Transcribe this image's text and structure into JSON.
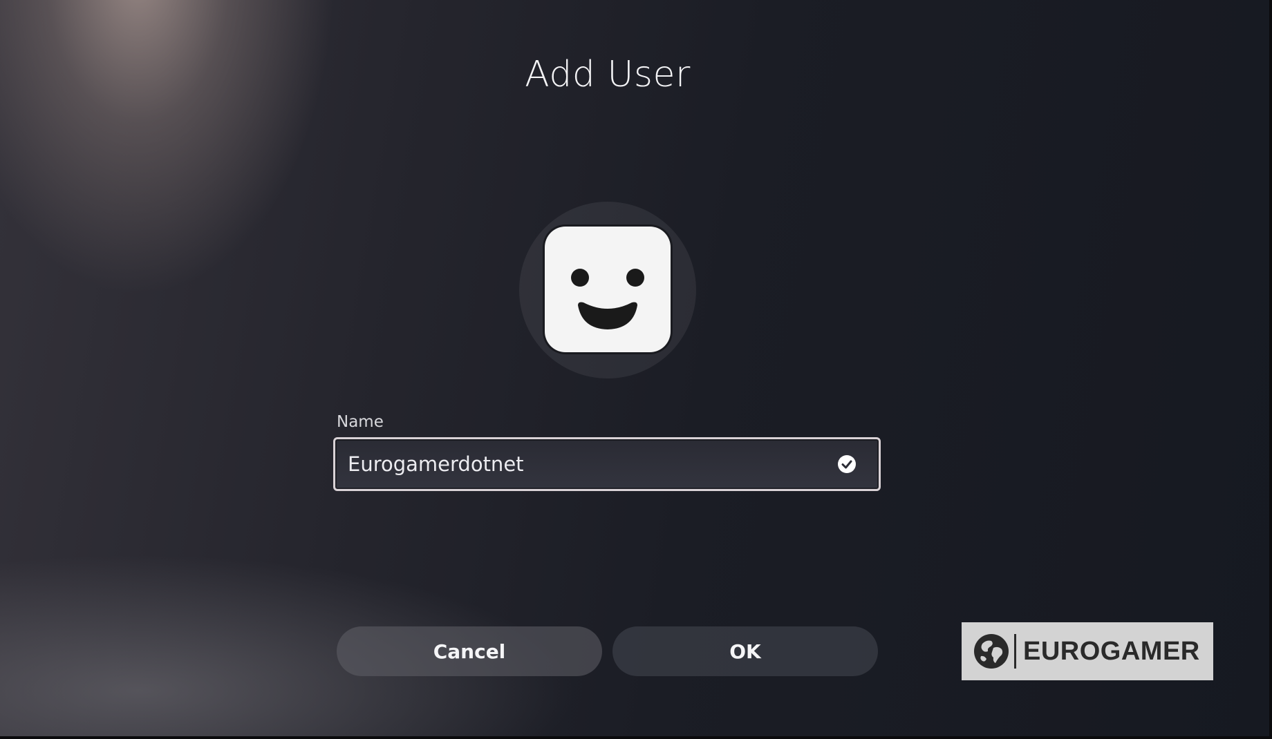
{
  "dialog": {
    "title": "Add User"
  },
  "avatar": {
    "icon": "smiley-face-icon",
    "tile_color": "#f4f4f4"
  },
  "name_field": {
    "label": "Name",
    "value": "Eurogamerdotnet",
    "status_icon": "check-circle-icon"
  },
  "actions": {
    "cancel_label": "Cancel",
    "ok_label": "OK"
  },
  "watermark": {
    "icon": "globe-icon",
    "brand": "EUROGAMER"
  }
}
